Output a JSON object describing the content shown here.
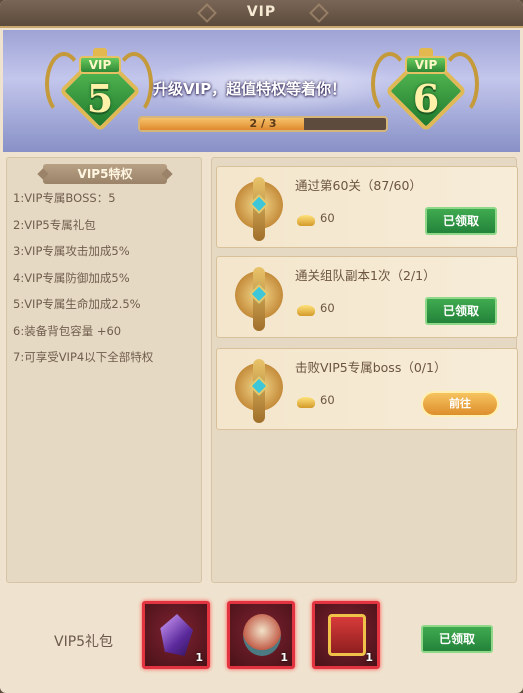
{
  "window": {
    "title": "VIP"
  },
  "banner": {
    "current_vip": {
      "label": "VIP",
      "level": "5"
    },
    "next_vip": {
      "label": "VIP",
      "level": "6"
    },
    "slogan": "升级VIP，超值特权等着你！",
    "progress": {
      "text": "2 / 3",
      "fraction": 0.667
    }
  },
  "privileges": {
    "header": "VIP5特权",
    "items": [
      "1:VIP专属BOSS：5",
      "2:VIP5专属礼包",
      "3:VIP专属攻击加成5%",
      "4:VIP专属防御加成5%",
      "5:VIP专属生命加成2.5%",
      "6:装备背包容量 +60",
      "7:可享受VIP4以下全部特权"
    ]
  },
  "tasks": [
    {
      "name": "通过第60关（87/60）",
      "reward": "60",
      "button": "已领取",
      "state": "claimed"
    },
    {
      "name": "通关组队副本1次（2/1）",
      "reward": "60",
      "button": "已领取",
      "state": "claimed"
    },
    {
      "name": "击败VIP5专属boss（0/1）",
      "reward": "60",
      "button": "前往",
      "state": "go"
    }
  ],
  "gift": {
    "label": "VIP5礼包",
    "items": [
      {
        "icon": "purple-crystal-icon",
        "count": "1"
      },
      {
        "icon": "treasure-bag-icon",
        "count": "1"
      },
      {
        "icon": "red-chest-icon",
        "count": "1"
      }
    ],
    "button": "已领取"
  },
  "colors": {
    "claimed_green": "#2f9a45",
    "go_orange": "#e9a03c",
    "item_border_red": "#e13340"
  }
}
